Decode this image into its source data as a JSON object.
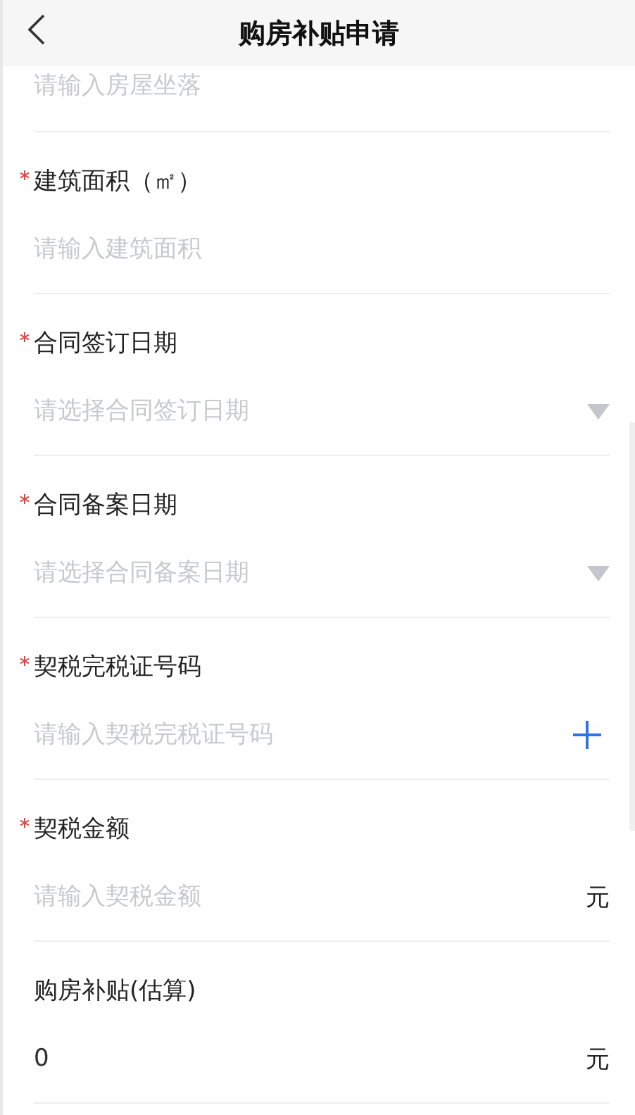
{
  "header": {
    "title": "购房补贴申请"
  },
  "partial_field": {
    "placeholder": "请输入房屋坐落"
  },
  "fields": [
    {
      "label": "建筑面积（㎡）",
      "required": true,
      "kind": "text",
      "placeholder": "请输入建筑面积"
    },
    {
      "label": "合同签订日期",
      "required": true,
      "kind": "select",
      "placeholder": "请选择合同签订日期"
    },
    {
      "label": "合同备案日期",
      "required": true,
      "kind": "select",
      "placeholder": "请选择合同备案日期"
    },
    {
      "label": "契税完税证号码",
      "required": true,
      "kind": "add",
      "placeholder": "请输入契税完税证号码"
    },
    {
      "label": "契税金额",
      "required": true,
      "kind": "unit",
      "placeholder": "请输入契税金额",
      "unit": "元"
    },
    {
      "label": "购房补贴(估算)",
      "required": false,
      "kind": "unit",
      "value": "0",
      "unit": "元"
    }
  ]
}
